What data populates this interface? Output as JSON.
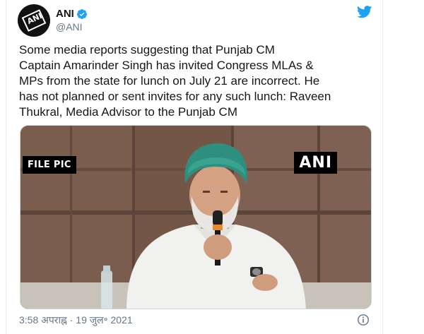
{
  "account": {
    "display_name": "ANI",
    "handle": "@ANI",
    "avatar_text": "ANI",
    "verified": true
  },
  "icons": {
    "verified": "verified-badge-icon",
    "bird": "twitter-bird-icon",
    "info": "info-icon"
  },
  "tweet": {
    "text_lines": [
      "Some media reports suggesting that Punjab CM",
      "Captain Amarinder Singh has invited Congress MLAs &",
      "MPs from the state for lunch on July 21 are incorrect. He",
      "has not planned or sent invites for any such lunch: Raveen",
      "Thukral, Media Advisor to the Punjab CM"
    ],
    "timestamp": "3:58 अपराह्न · 19 जुल॰ 2021"
  },
  "media": {
    "left_badge": "FILE PIC",
    "right_badge": "ANI"
  },
  "colors": {
    "accent": "#1da1f2",
    "text": "#14171a",
    "muted": "#657786",
    "turban": "#2f8f7e",
    "shirt": "#f2f2f2",
    "background_wood": "#7a5a4a"
  }
}
